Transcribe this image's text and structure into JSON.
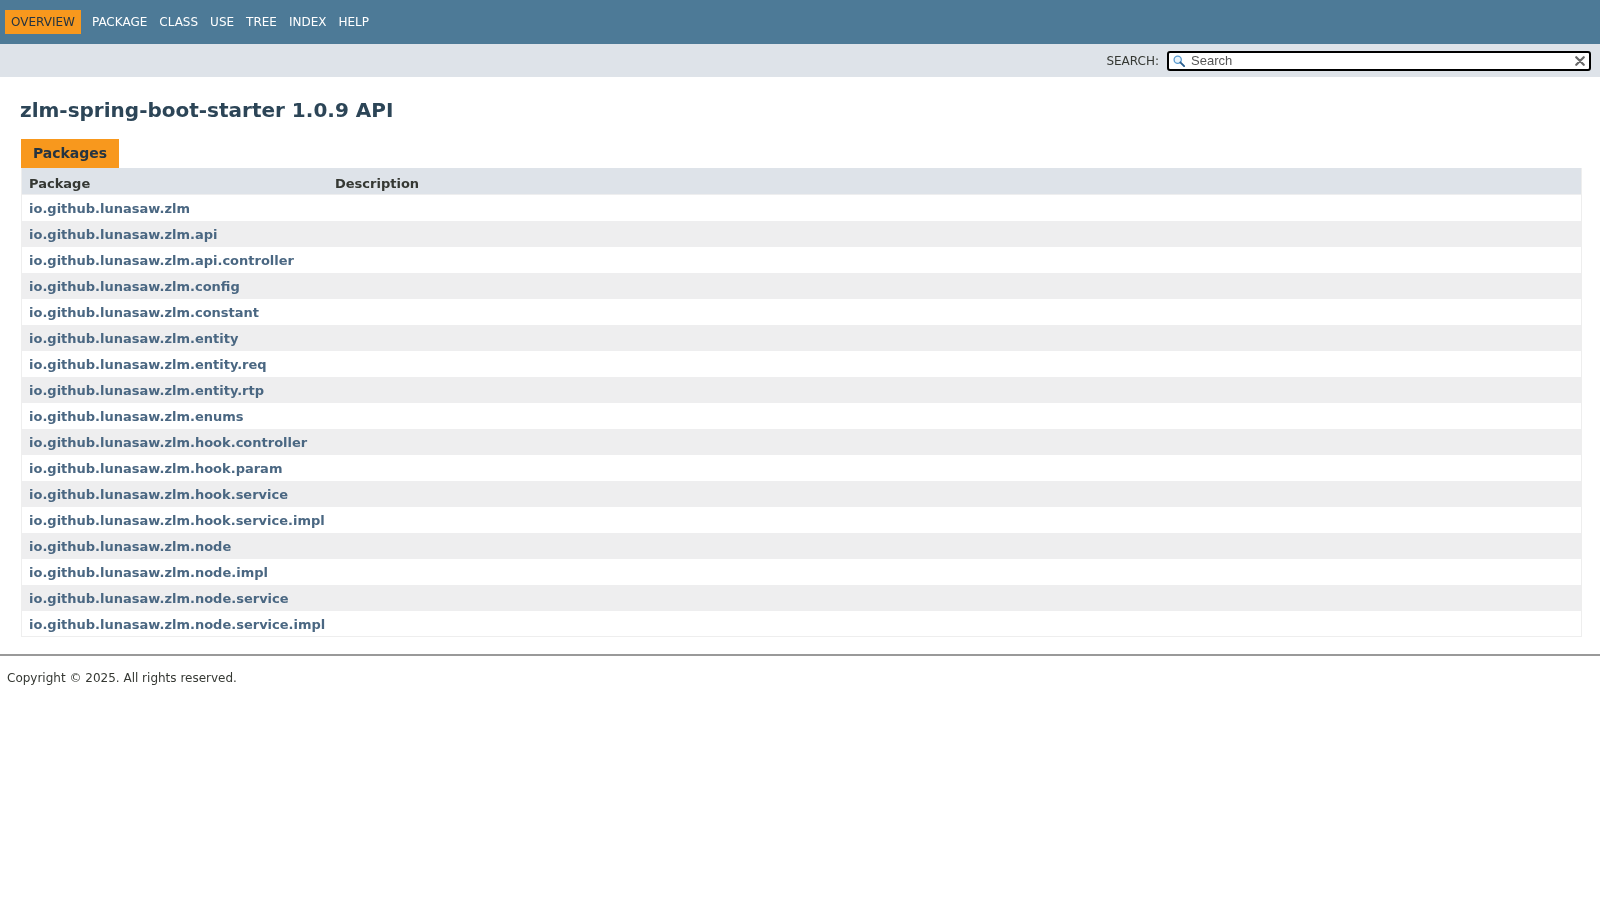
{
  "nav": {
    "items": [
      {
        "label": "OVERVIEW",
        "selected": true
      },
      {
        "label": "PACKAGE",
        "selected": false
      },
      {
        "label": "CLASS",
        "selected": false
      },
      {
        "label": "USE",
        "selected": false
      },
      {
        "label": "TREE",
        "selected": false
      },
      {
        "label": "INDEX",
        "selected": false
      },
      {
        "label": "HELP",
        "selected": false
      }
    ]
  },
  "search": {
    "label": "SEARCH:",
    "placeholder": "Search"
  },
  "title": "zlm-spring-boot-starter 1.0.9 API",
  "packages_table": {
    "tab": {
      "label": "Packages",
      "selected": true
    },
    "columns": [
      "Package",
      "Description"
    ],
    "rows": [
      {
        "package": "io.github.lunasaw.zlm"
      },
      {
        "package": "io.github.lunasaw.zlm.api"
      },
      {
        "package": "io.github.lunasaw.zlm.api.controller"
      },
      {
        "package": "io.github.lunasaw.zlm.config"
      },
      {
        "package": "io.github.lunasaw.zlm.constant"
      },
      {
        "package": "io.github.lunasaw.zlm.entity"
      },
      {
        "package": "io.github.lunasaw.zlm.entity.req"
      },
      {
        "package": "io.github.lunasaw.zlm.entity.rtp"
      },
      {
        "package": "io.github.lunasaw.zlm.enums"
      },
      {
        "package": "io.github.lunasaw.zlm.hook.controller"
      },
      {
        "package": "io.github.lunasaw.zlm.hook.param"
      },
      {
        "package": "io.github.lunasaw.zlm.hook.service"
      },
      {
        "package": "io.github.lunasaw.zlm.hook.service.impl"
      },
      {
        "package": "io.github.lunasaw.zlm.node"
      },
      {
        "package": "io.github.lunasaw.zlm.node.impl"
      },
      {
        "package": "io.github.lunasaw.zlm.node.service"
      },
      {
        "package": "io.github.lunasaw.zlm.node.service.impl"
      }
    ]
  },
  "footer": {
    "copyright": "Copyright © 2025. All rights reserved."
  }
}
